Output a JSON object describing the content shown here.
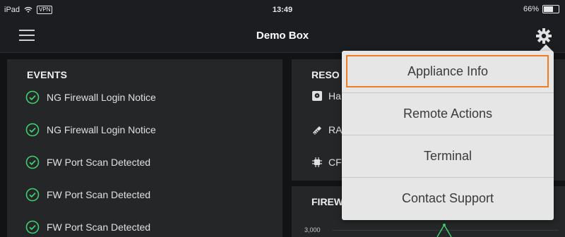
{
  "status_bar": {
    "device": "iPad",
    "vpn": "VPN",
    "time": "13:49",
    "battery": "66%",
    "battery_level": 0.66
  },
  "nav": {
    "title": "Demo Box"
  },
  "events": {
    "title": "EVENTS",
    "items": [
      "NG Firewall Login Notice",
      "NG Firewall Login Notice",
      "FW Port Scan Detected",
      "FW Port Scan Detected",
      "FW Port Scan Detected"
    ]
  },
  "resources": {
    "title": "RESO",
    "rows": [
      "Ha",
      "RA",
      "CF"
    ]
  },
  "firewall": {
    "title": "FIREW",
    "ytick": "3,000"
  },
  "menu": {
    "items": [
      "Appliance Info",
      "Remote Actions",
      "Terminal",
      "Contact Support"
    ],
    "highlighted": "Appliance Info"
  },
  "colors": {
    "accent_green": "#3ecf6e",
    "highlight_orange": "#f07d1f"
  }
}
